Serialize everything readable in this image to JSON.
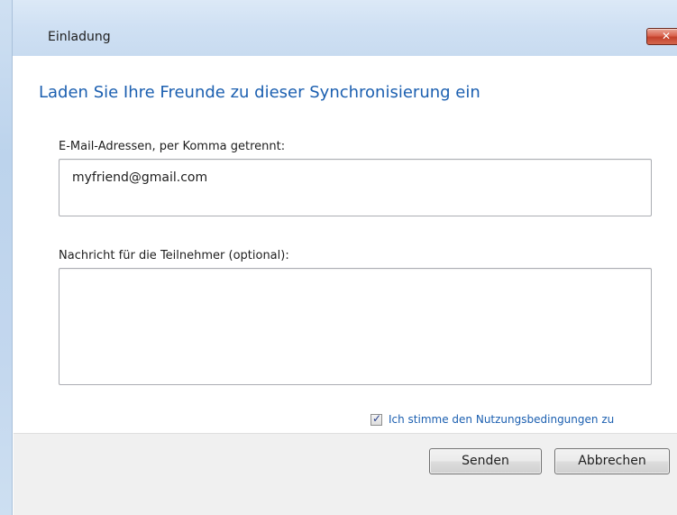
{
  "window": {
    "title": "Einladung",
    "close_glyph": "✕"
  },
  "main": {
    "heading": "Laden Sie Ihre Freunde zu dieser Synchronisierung ein",
    "email_label": "E-Mail-Adressen, per Komma getrennt:",
    "email_value": "myfriend@gmail.com",
    "message_label": "Nachricht für die Teilnehmer (optional):",
    "message_value": "",
    "terms_label": "Ich stimme den Nutzungsbedingungen zu",
    "terms_checked": true,
    "check_glyph": "✓"
  },
  "footer": {
    "send_label": "Senden",
    "cancel_label": "Abbrechen"
  },
  "colors": {
    "accent": "#1b5fb0",
    "close_button": "#c4412b"
  }
}
